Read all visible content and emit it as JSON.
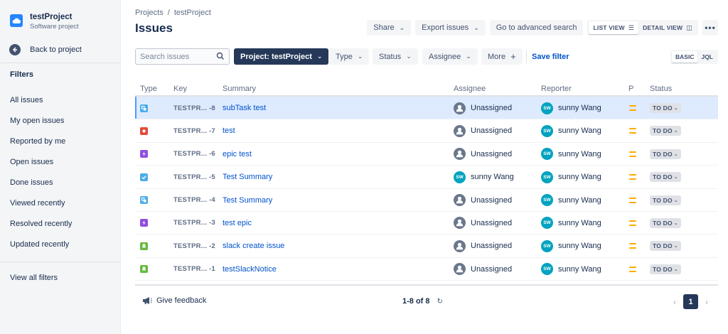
{
  "sidebar": {
    "project_name": "testProject",
    "project_type": "Software project",
    "back_label": "Back to project",
    "filters_heading": "Filters",
    "items": [
      {
        "label": "All issues"
      },
      {
        "label": "My open issues"
      },
      {
        "label": "Reported by me"
      },
      {
        "label": "Open issues"
      },
      {
        "label": "Done issues"
      },
      {
        "label": "Viewed recently"
      },
      {
        "label": "Resolved recently"
      },
      {
        "label": "Updated recently"
      }
    ],
    "view_all": "View all filters"
  },
  "breadcrumb": {
    "root": "Projects",
    "sep": "/",
    "project": "testProject"
  },
  "page_title": "Issues",
  "toolbar": {
    "share": "Share",
    "export": "Export issues",
    "advanced": "Go to advanced search",
    "list_view": "LIST VIEW",
    "detail_view": "DETAIL VIEW",
    "more": "•••"
  },
  "filters": {
    "search_placeholder": "Search issues",
    "project": "Project: testProject",
    "type": "Type",
    "status": "Status",
    "assignee": "Assignee",
    "more": "More",
    "save": "Save filter",
    "basic": "BASIC",
    "jql": "JQL"
  },
  "table": {
    "headers": {
      "type": "Type",
      "key": "Key",
      "summary": "Summary",
      "assignee": "Assignee",
      "reporter": "Reporter",
      "priority": "P",
      "status": "Status"
    },
    "rows": [
      {
        "type_icon": "subtask-icon",
        "type_color": "#4bade8",
        "key": "TESTPR... -8",
        "summary": "subTask test",
        "assignee": "Unassigned",
        "assignee_avatar": "unassigned",
        "reporter": "sunny Wang",
        "status": "TO DO"
      },
      {
        "type_icon": "bug-icon",
        "type_color": "#e5493a",
        "key": "TESTPR... -7",
        "summary": "test",
        "assignee": "Unassigned",
        "assignee_avatar": "unassigned",
        "reporter": "sunny Wang",
        "status": "TO DO"
      },
      {
        "type_icon": "epic-icon",
        "type_color": "#904ee2",
        "key": "TESTPR... -6",
        "summary": "epic test",
        "assignee": "Unassigned",
        "assignee_avatar": "unassigned",
        "reporter": "sunny Wang",
        "status": "TO DO"
      },
      {
        "type_icon": "task-icon",
        "type_color": "#4bade8",
        "key": "TESTPR... -5",
        "summary": "Test Summary",
        "assignee": "sunny Wang",
        "assignee_avatar": "SW",
        "reporter": "sunny Wang",
        "status": "TO DO"
      },
      {
        "type_icon": "subtask-icon",
        "type_color": "#4bade8",
        "key": "TESTPR... -4",
        "summary": "Test Summary",
        "assignee": "Unassigned",
        "assignee_avatar": "unassigned",
        "reporter": "sunny Wang",
        "status": "TO DO"
      },
      {
        "type_icon": "epic-icon",
        "type_color": "#904ee2",
        "key": "TESTPR... -3",
        "summary": "test epic",
        "assignee": "Unassigned",
        "assignee_avatar": "unassigned",
        "reporter": "sunny Wang",
        "status": "TO DO"
      },
      {
        "type_icon": "story-icon",
        "type_color": "#63ba3c",
        "key": "TESTPR... -2",
        "summary": "slack create issue",
        "assignee": "Unassigned",
        "assignee_avatar": "unassigned",
        "reporter": "sunny Wang",
        "status": "TO DO"
      },
      {
        "type_icon": "story-icon",
        "type_color": "#63ba3c",
        "key": "TESTPR... -1",
        "summary": "testSlackNotice",
        "assignee": "Unassigned",
        "assignee_avatar": "unassigned",
        "reporter": "sunny Wang",
        "status": "TO DO"
      }
    ],
    "reporter_avatar": "SW",
    "priority_color": "#ffab00"
  },
  "footer": {
    "feedback": "Give feedback",
    "count": "1-8 of 8",
    "page": "1"
  }
}
